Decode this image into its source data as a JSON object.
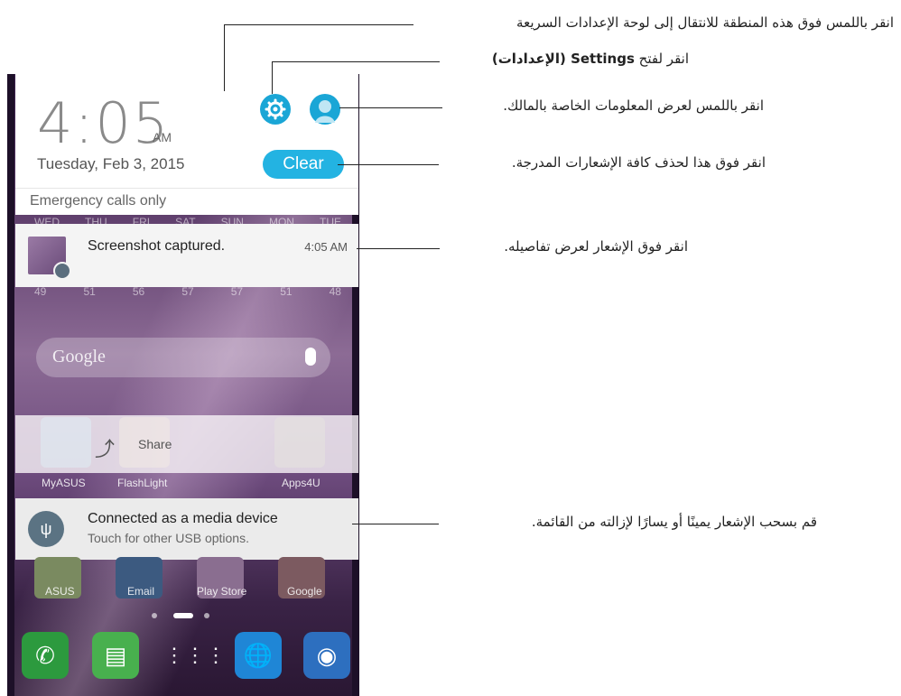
{
  "phone": {
    "time": "4:05",
    "ampm": "AM",
    "date": "Tuesday, Feb 3, 2015",
    "clear_label": "Clear",
    "emergency": "Emergency calls only",
    "weekdays": [
      "WED",
      "THU",
      "FRI",
      "SAT",
      "SUN",
      "MON",
      "TUE"
    ],
    "temps": [
      "49",
      "51",
      "56",
      "57",
      "57",
      "51",
      "48"
    ],
    "notification": {
      "title": "Screenshot captured.",
      "time": "4:05 AM"
    },
    "search_text": "Google",
    "share_label": "Share",
    "apps_row1": [
      "MyASUS",
      "FlashLight",
      "Apps4U"
    ],
    "usb_notification": {
      "title": "Connected as a media device",
      "subtitle": "Touch for other USB options."
    },
    "apps_row2": [
      "ASUS",
      "Email",
      "Play Store",
      "Google"
    ],
    "dock_icons": [
      "phone-icon",
      "messages-icon",
      "app-drawer-icon",
      "browser-icon",
      "camera-icon"
    ]
  },
  "callouts": {
    "quick_settings": "انقر باللمس فوق هذه المنطقة للانتقال إلى لوحة الإعدادات السريعة",
    "settings_prefix": "انقر لفتح",
    "settings_bold": "Settings (الإعدادات)",
    "owner": "انقر باللمس لعرض المعلومات الخاصة بالمالك.",
    "clear": "انقر فوق هذا لحذف كافة الإشعارات المدرجة.",
    "notification": "انقر فوق الإشعار لعرض تفاصيله.",
    "swipe": "قم بسحب الإشعار يمينًا أو يسارًا لإزالته من القائمة."
  },
  "colors": {
    "accent": "#1aa6d6",
    "clear_button": "#23b3e2"
  }
}
